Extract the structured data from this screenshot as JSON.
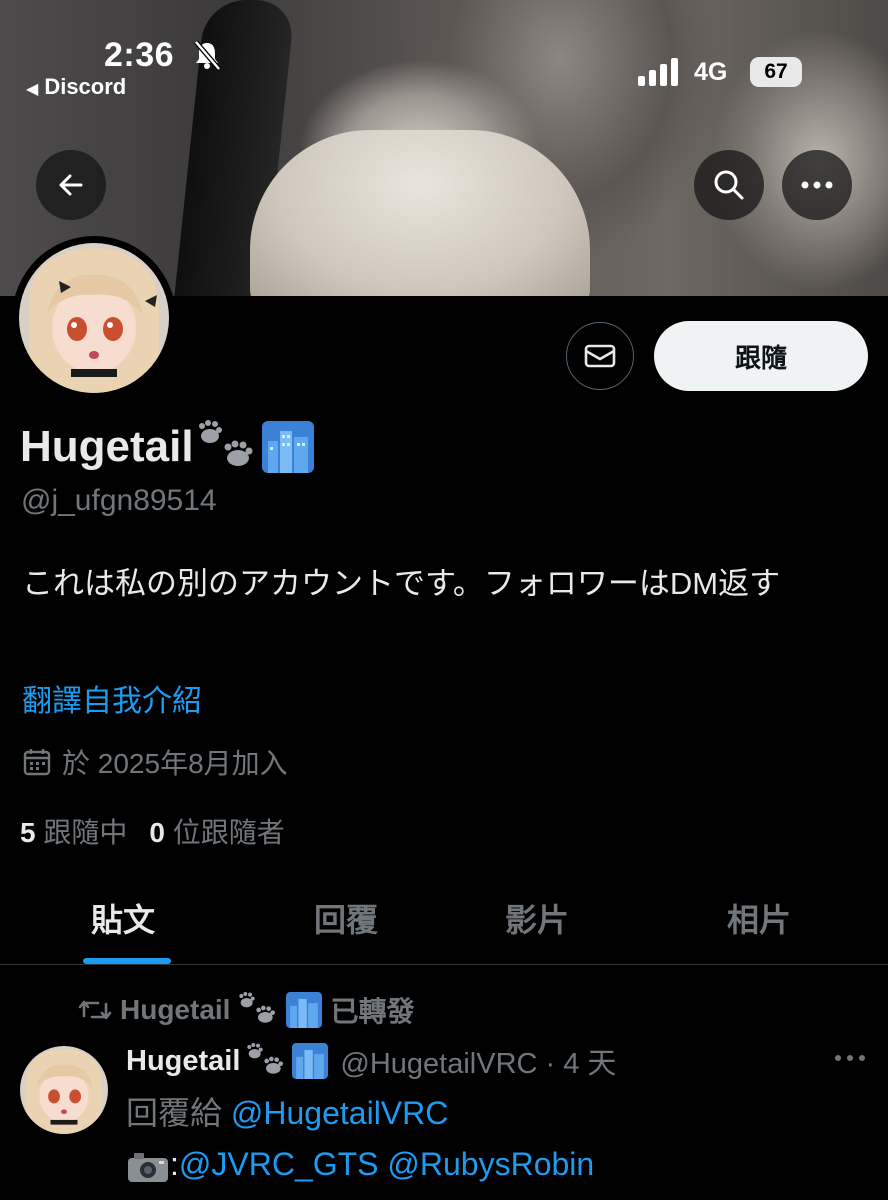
{
  "status_bar": {
    "time": "2:36",
    "back_app": "Discord",
    "network": "4G",
    "battery": "67"
  },
  "profile": {
    "display_name": "Hugetail",
    "handle": "@j_ufgn89514",
    "bio": "これは私の別のアカウントです。フォロワーはDM返す",
    "translate_label": "翻譯自我介紹",
    "joined": "於 2025年8月加入",
    "following_count": "5",
    "following_label": "跟隨中",
    "followers_count": "0",
    "followers_label": "位跟隨者",
    "follow_button": "跟隨"
  },
  "tabs": [
    {
      "label": "貼文",
      "active": true
    },
    {
      "label": "回覆",
      "active": false
    },
    {
      "label": "影片",
      "active": false
    },
    {
      "label": "相片",
      "active": false
    }
  ],
  "post": {
    "repost_by": "Hugetail",
    "repost_label": "已轉發",
    "author_name": "Hugetail",
    "author_meta": "@HugetailVRC · 4 天",
    "reply_prefix": "回覆給",
    "reply_handle": "@HugetailVRC",
    "body_prefix": ":",
    "body_mention_1": "@JVRC_GTS",
    "body_mention_2": "@RubysRobin"
  },
  "icons": {
    "back": "arrow-left-icon",
    "search": "search-icon",
    "more": "more-icon",
    "mail": "mail-icon",
    "calendar": "calendar-icon",
    "repost": "repost-icon",
    "camera": "camera-emoji",
    "paws": "paw-prints-emoji",
    "city": "cityscape-emoji"
  },
  "colors": {
    "background": "#000000",
    "accent": "#1d9bf0",
    "muted": "#71767b",
    "text": "#e7e9ea"
  }
}
